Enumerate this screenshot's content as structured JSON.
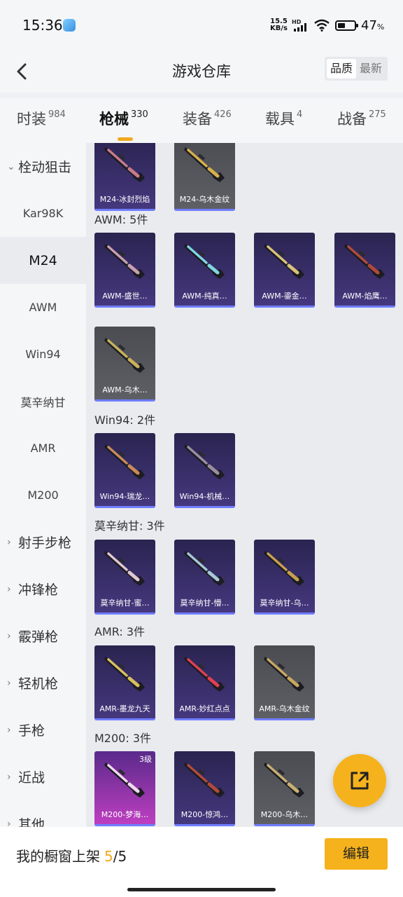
{
  "status_bar": {
    "time": "15:36",
    "net_speed_value": "15.5",
    "net_speed_unit": "KB/s",
    "net_type": "HD",
    "battery_pct": "47",
    "battery_pct_unit": "%",
    "battery_level": 0.47
  },
  "header": {
    "title": "游戏仓库",
    "sort_options": [
      "品质",
      "最新"
    ]
  },
  "tabs": [
    {
      "label": "时装",
      "count": "984"
    },
    {
      "label": "枪械",
      "count": "330"
    },
    {
      "label": "装备",
      "count": "426"
    },
    {
      "label": "载具",
      "count": "4"
    },
    {
      "label": "战备",
      "count": "275"
    }
  ],
  "sidebar": {
    "items": [
      {
        "label": "栓动狙击",
        "type": "group",
        "expanded": true
      },
      {
        "label": "Kar98K",
        "type": "sub"
      },
      {
        "label": "M24",
        "type": "sub",
        "selected": true
      },
      {
        "label": "AWM",
        "type": "sub"
      },
      {
        "label": "Win94",
        "type": "sub"
      },
      {
        "label": "莫辛纳甘",
        "type": "sub"
      },
      {
        "label": "AMR",
        "type": "sub"
      },
      {
        "label": "M200",
        "type": "sub"
      },
      {
        "label": "射手步枪",
        "type": "group"
      },
      {
        "label": "冲锋枪",
        "type": "group"
      },
      {
        "label": "霰弹枪",
        "type": "group"
      },
      {
        "label": "轻机枪",
        "type": "group"
      },
      {
        "label": "手枪",
        "type": "group"
      },
      {
        "label": "近战",
        "type": "group"
      },
      {
        "label": "其他",
        "type": "group"
      }
    ]
  },
  "sections": [
    {
      "title": "",
      "items": [
        {
          "name": "M24-冰封烈焰",
          "bg": "purple"
        },
        {
          "name": "M24-乌木金纹",
          "bg": "gray"
        }
      ]
    },
    {
      "title": "AWM: 5件",
      "items": [
        {
          "name": "AWM-盛世…",
          "bg": "purple"
        },
        {
          "name": "AWM-纯真…",
          "bg": "purple"
        },
        {
          "name": "AWM-鎏金…",
          "bg": "purple"
        },
        {
          "name": "AWM-焰鹰…",
          "bg": "purple"
        },
        {
          "name": "AWM-乌木…",
          "bg": "gray"
        }
      ]
    },
    {
      "title": "Win94: 2件",
      "items": [
        {
          "name": "Win94-瑞龙…",
          "bg": "purple"
        },
        {
          "name": "Win94-机械…",
          "bg": "purple"
        }
      ]
    },
    {
      "title": "莫辛纳甘: 3件",
      "items": [
        {
          "name": "莫辛纳甘-蜜…",
          "bg": "purple"
        },
        {
          "name": "莫辛纳甘-懵…",
          "bg": "purple"
        },
        {
          "name": "莫辛纳甘-乌…",
          "bg": "purple"
        }
      ]
    },
    {
      "title": "AMR: 3件",
      "items": [
        {
          "name": "AMR-墨龙九天",
          "bg": "purple"
        },
        {
          "name": "AMR-妙红点点",
          "bg": "purple"
        },
        {
          "name": "AMR-乌木金纹",
          "bg": "gray"
        }
      ]
    },
    {
      "title": "M200: 3件",
      "items": [
        {
          "name": "M200-梦海…",
          "bg": "pink",
          "tier": "3级"
        },
        {
          "name": "M200-惊鸿…",
          "bg": "purple"
        },
        {
          "name": "M200-乌木…",
          "bg": "gray"
        }
      ]
    }
  ],
  "bottom_bar": {
    "showcase_label": "我的橱窗上架",
    "showcase_count": "5",
    "showcase_total": "/5",
    "edit_label": "编辑"
  },
  "colors": {
    "accent": "#f5b21c",
    "card_purple": "#46387f",
    "card_gray": "#5e6066",
    "card_pink": "#c03fc2",
    "rarity_bar": "#6f7dff"
  }
}
